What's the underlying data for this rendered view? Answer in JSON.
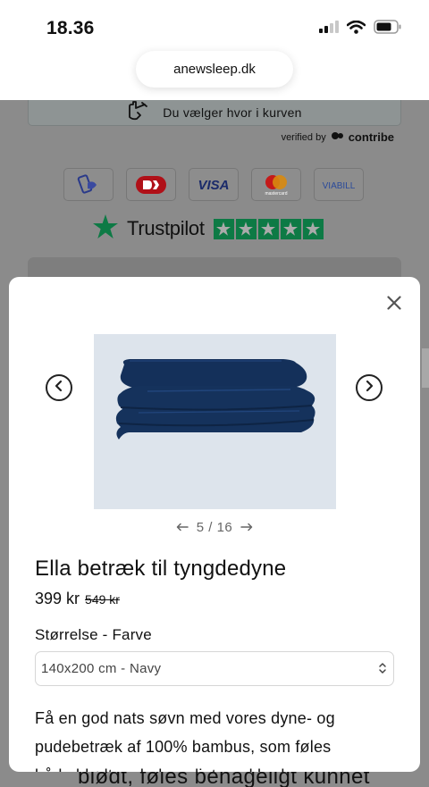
{
  "status_bar": {
    "time": "18.36"
  },
  "browser": {
    "url": "anewsleep.dk"
  },
  "background_page": {
    "cart_text": "Du vælger hvor i kurven",
    "verified_by": "verified by",
    "verified_brand": "contribe",
    "payment_methods": [
      "MobilePay",
      "Dankort",
      "VISA",
      "mastercard",
      "ViaBill"
    ],
    "trustpilot_name": "Trustpilot",
    "trustpilot_stars": 5,
    "bleed_text": "blødt, føles behageligt kunnet"
  },
  "modal": {
    "gallery_counter": "5 / 16",
    "product_title": "Ella betræk til tyngdedyne",
    "price": "399 kr",
    "old_price": "549 kr",
    "option_label": "Størrelse - Farve",
    "selected_option": "140x200 cm - Navy",
    "description_line1": "Få en god nats søvn med vores dyne- og",
    "description_line2": "pudebetræk af 100% bambus, som føles",
    "description_line3": "både blødt og behageligt mod huden"
  },
  "colors": {
    "duvet_navy": "#16325a",
    "image_bg": "#dde4ec",
    "trustpilot_green": "#0d7a45"
  }
}
